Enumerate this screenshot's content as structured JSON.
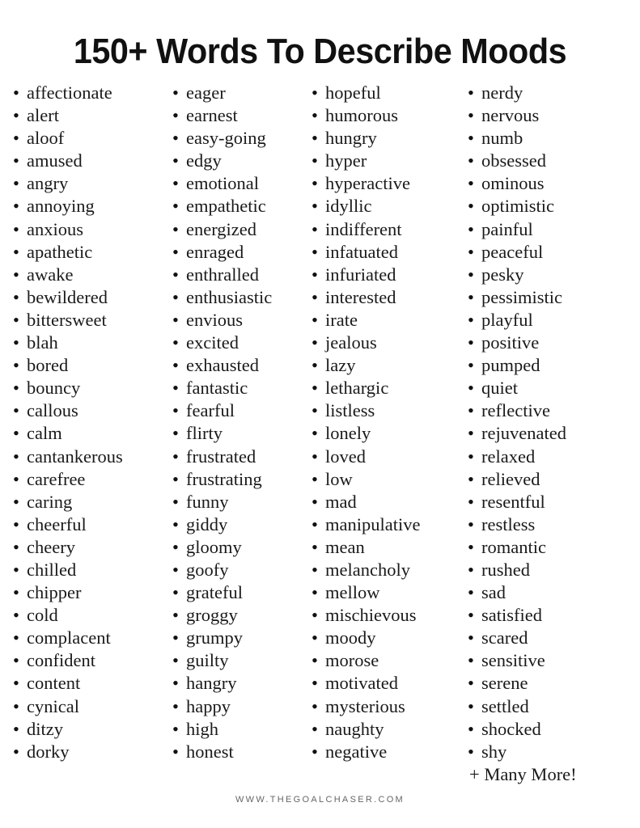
{
  "page": {
    "title": "150+ Words To Describe Moods",
    "background_color": "#ffffff",
    "text_color": "#1a1a1a",
    "footer_color": "#666666",
    "bullet_glyph": "•"
  },
  "columns": [
    {
      "id": "column-1",
      "words": [
        "affectionate",
        "alert",
        "aloof",
        "amused",
        "angry",
        "annoying",
        "anxious",
        "apathetic",
        "awake",
        "bewildered",
        "bittersweet",
        "blah",
        "bored",
        "bouncy",
        "callous",
        "calm",
        "cantankerous",
        "carefree",
        "caring",
        "cheerful",
        "cheery",
        "chilled",
        "chipper",
        "cold",
        "complacent",
        "confident",
        "content",
        "cynical",
        "ditzy",
        "dorky"
      ]
    },
    {
      "id": "column-2",
      "words": [
        "eager",
        "earnest",
        "easy-going",
        "edgy",
        "emotional",
        "empathetic",
        "energized",
        "enraged",
        "enthralled",
        "enthusiastic",
        "envious",
        "excited",
        "exhausted",
        "fantastic",
        "fearful",
        "flirty",
        "frustrated",
        "frustrating",
        "funny",
        "giddy",
        "gloomy",
        "goofy",
        "grateful",
        "groggy",
        "grumpy",
        "guilty",
        "hangry",
        "happy",
        "high",
        "honest"
      ]
    },
    {
      "id": "column-3",
      "words": [
        "hopeful",
        "humorous",
        "hungry",
        "hyper",
        "hyperactive",
        "idyllic",
        "indifferent",
        "infatuated",
        "infuriated",
        "interested",
        "irate",
        "jealous",
        "lazy",
        "lethargic",
        "listless",
        "lonely",
        "loved",
        "low",
        "mad",
        "manipulative",
        "mean",
        "melancholy",
        "mellow",
        "mischievous",
        "moody",
        "morose",
        "motivated",
        "mysterious",
        "naughty",
        "negative"
      ]
    },
    {
      "id": "column-4",
      "words": [
        "nerdy",
        "nervous",
        "numb",
        "obsessed",
        "ominous",
        "optimistic",
        "painful",
        "peaceful",
        "pesky",
        "pessimistic",
        "playful",
        "positive",
        "pumped",
        "quiet",
        "reflective",
        "rejuvenated",
        "relaxed",
        "relieved",
        "resentful",
        "restless",
        "romantic",
        "rushed",
        "sad",
        "satisfied",
        "scared",
        "sensitive",
        "serene",
        "settled",
        "shocked",
        "shy"
      ],
      "trailing_note": "+ Many More!"
    }
  ],
  "footer": {
    "website": "WWW.THEGOALCHASER.COM"
  }
}
